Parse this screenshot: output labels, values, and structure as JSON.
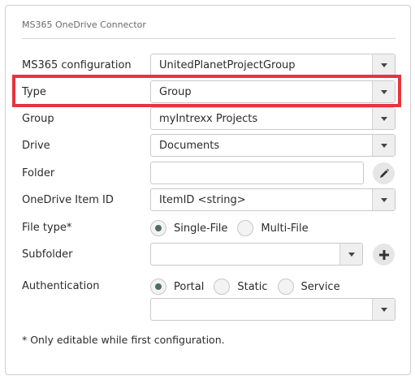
{
  "panel": {
    "title": "MS365 OneDrive Connector"
  },
  "fields": {
    "ms365_configuration": {
      "label": "MS365 configuration",
      "value": "UnitedPlanetProjectGroup"
    },
    "type": {
      "label": "Type",
      "value": "Group"
    },
    "group": {
      "label": "Group",
      "value": "myIntrexx Projects"
    },
    "drive": {
      "label": "Drive",
      "value": "Documents"
    },
    "folder": {
      "label": "Folder",
      "value": "",
      "button_icon": "pencil-icon"
    },
    "onedrive_item_id": {
      "label": "OneDrive Item ID",
      "value": "ItemID <string>"
    },
    "file_type": {
      "label": "File type*",
      "options": [
        "Single-File",
        "Multi-File"
      ],
      "selected": "Single-File"
    },
    "subfolder": {
      "label": "Subfolder",
      "value": "",
      "button_icon": "plus-icon"
    },
    "authentication": {
      "label": "Authentication",
      "options": [
        "Portal",
        "Static",
        "Service"
      ],
      "selected": "Portal",
      "value": ""
    }
  },
  "footnote": "* Only editable while first configuration.",
  "colors": {
    "highlight": "#e8343c",
    "radio_selected": "#4c6e5c"
  }
}
